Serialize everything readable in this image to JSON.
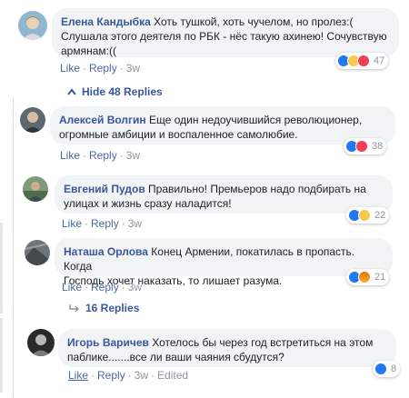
{
  "comments": [
    {
      "author": "Елена Кандыбка",
      "text_line1": " Хоть тушкой, хоть чучелом, но пролез:(",
      "text_line2": "Слушала этого деятеля по РБК - нёс такую ахинею! Сочувствую",
      "text_line3": "армянам:((",
      "like_label": "Like",
      "reply_label": "Reply",
      "time": "3w",
      "reactions": [
        "like",
        "sad",
        "love"
      ],
      "reaction_count": "47"
    },
    {
      "author": "Алексей Волгин",
      "text_line1": " Еще один недоучившийся революционер,",
      "text_line2": "огромные амбиции и воспаленное самолюбие.",
      "like_label": "Like",
      "reply_label": "Reply",
      "time": "3w",
      "reactions": [
        "like",
        "love"
      ],
      "reaction_count": "38"
    },
    {
      "author": "Евгений Пудов",
      "text_line1": " Правильно! Премьеров надо подбирать на",
      "text_line2": "улицах и жизнь сразу наладится!",
      "like_label": "Like",
      "reply_label": "Reply",
      "time": "3w",
      "reactions": [
        "like",
        "haha"
      ],
      "reaction_count": "22"
    },
    {
      "author": "Наташа Орлова",
      "text_line1": " Конец Армении, покатилась в пропасть. Когда",
      "text_line2": "Господь хочет наказать, то лишает разума.",
      "like_label": "Like",
      "reply_label": "Reply",
      "time": "3w",
      "reactions": [
        "like",
        "angry"
      ],
      "reaction_count": "21"
    },
    {
      "author": "Игорь Варичев",
      "text_line1": " Хотелось бы через год встретиться на этом",
      "text_line2": "паблике.......все ли ваши чаяния сбудутся?",
      "like_label": "Like",
      "reply_label": "Reply",
      "time": "3w",
      "edited": "Edited",
      "reactions": [
        "like"
      ],
      "reaction_count": "8"
    }
  ],
  "hide_replies": "Hide 48 Replies",
  "more_replies": "16 Replies",
  "colors": {
    "link": "#385898",
    "bubble": "#f2f3f5",
    "meta": "#90949c"
  }
}
